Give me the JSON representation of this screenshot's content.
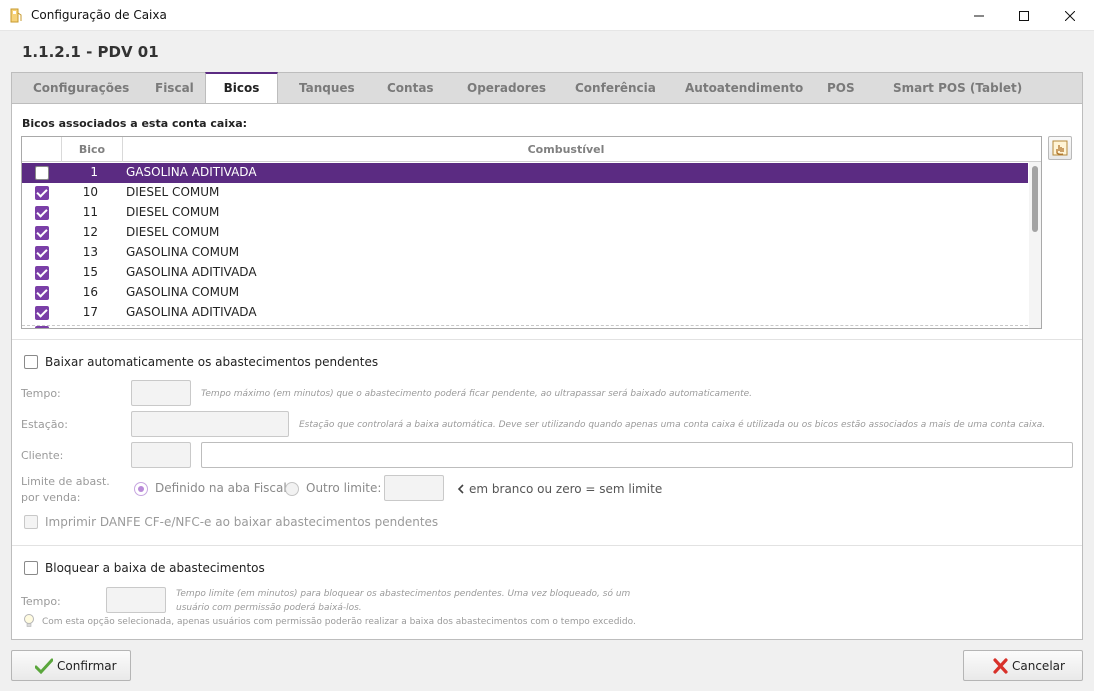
{
  "window": {
    "title": "Configuração de Caixa"
  },
  "page": {
    "title": "1.1.2.1 - PDV 01"
  },
  "tabs": [
    {
      "label": "Configurações"
    },
    {
      "label": "Fiscal"
    },
    {
      "label": "Bicos"
    },
    {
      "label": "Tanques"
    },
    {
      "label": "Contas"
    },
    {
      "label": "Operadores"
    },
    {
      "label": "Conferência"
    },
    {
      "label": "Autoatendimento"
    },
    {
      "label": "POS"
    },
    {
      "label": "Smart POS (Tablet)"
    }
  ],
  "active_tab": "Bicos",
  "bicos": {
    "section_label": "Bicos associados a esta conta caixa:",
    "columns": {
      "bico": "Bico",
      "combustivel": "Combustível"
    },
    "rows": [
      {
        "checked": false,
        "bico": "1",
        "combustivel": "GASOLINA ADITIVADA",
        "selected": true
      },
      {
        "checked": true,
        "bico": "10",
        "combustivel": "DIESEL COMUM",
        "selected": false
      },
      {
        "checked": true,
        "bico": "11",
        "combustivel": "DIESEL COMUM",
        "selected": false
      },
      {
        "checked": true,
        "bico": "12",
        "combustivel": "DIESEL COMUM",
        "selected": false
      },
      {
        "checked": true,
        "bico": "13",
        "combustivel": "GASOLINA COMUM",
        "selected": false
      },
      {
        "checked": true,
        "bico": "15",
        "combustivel": "GASOLINA ADITIVADA",
        "selected": false
      },
      {
        "checked": true,
        "bico": "16",
        "combustivel": "GASOLINA COMUM",
        "selected": false
      },
      {
        "checked": true,
        "bico": "17",
        "combustivel": "GASOLINA ADITIVADA",
        "selected": false
      }
    ]
  },
  "baixa_auto": {
    "checkbox_label": "Baixar automaticamente os abastecimentos pendentes",
    "tempo_label": "Tempo:",
    "tempo_hint": "Tempo máximo (em minutos) que o abastecimento poderá ficar pendente, ao ultrapassar será baixado automaticamente.",
    "estacao_label": "Estação:",
    "estacao_hint": "Estação que controlará a baixa automática. Deve ser utilizando quando apenas uma conta caixa é utilizada ou os bicos estão associados a mais de uma conta caixa.",
    "cliente_label": "Cliente:",
    "limite_label_1": "Limite de abast.",
    "limite_label_2": "por venda:",
    "radio_fiscal": "Definido na aba Fiscal",
    "radio_outro": "Outro limite:",
    "limite_hint": "em branco ou zero = sem limite",
    "imprimir_label": "Imprimir DANFE CF-e/NFC-e ao baixar abastecimentos pendentes"
  },
  "bloquear": {
    "checkbox_label": "Bloquear a baixa de abastecimentos",
    "tempo_label": "Tempo:",
    "tempo_hint_1": "Tempo limite (em minutos) para bloquear os abastecimentos pendentes. Uma vez bloqueado, só um",
    "tempo_hint_2": "usuário com permissão poderá baixá-los.",
    "info_text": "Com esta opção selecionada, apenas usuários com permissão poderão realizar a baixa dos abastecimentos com o tempo excedido."
  },
  "buttons": {
    "confirm": "Confirmar",
    "cancel": "Cancelar"
  },
  "colors": {
    "accent": "#5b2b82",
    "check": "#7a3fa7"
  }
}
